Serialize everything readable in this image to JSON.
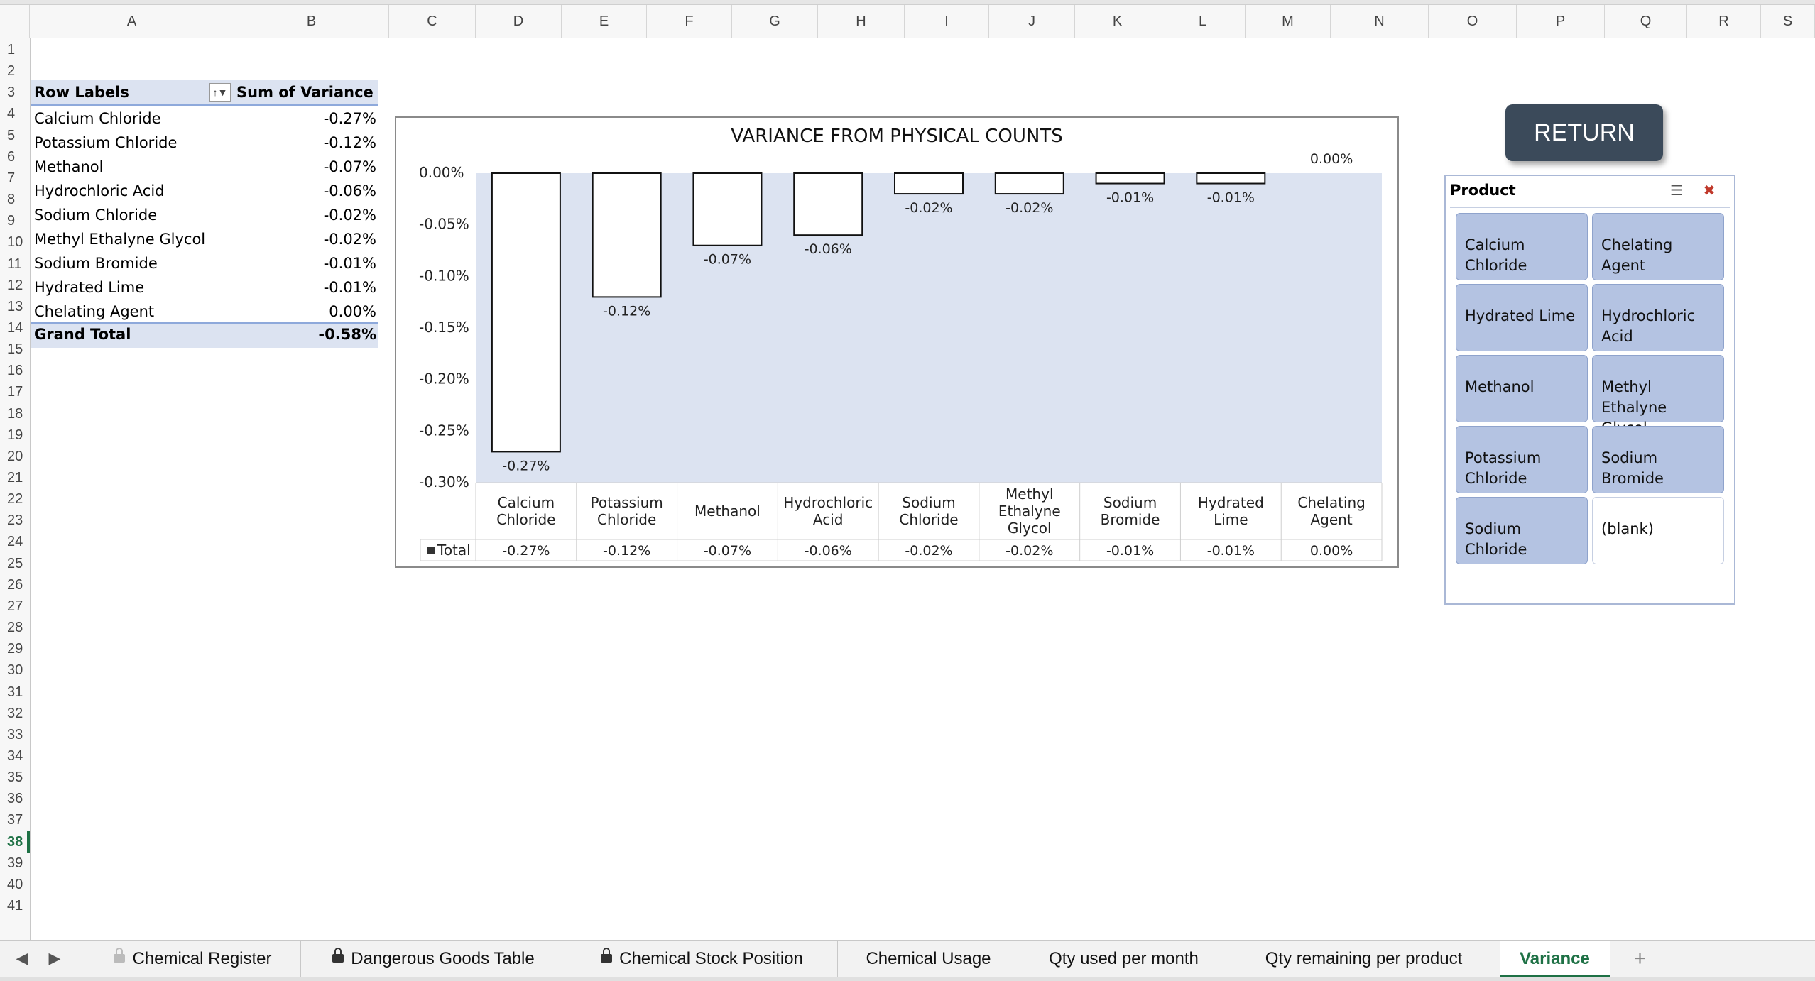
{
  "columns": [
    "A",
    "B",
    "C",
    "D",
    "E",
    "F",
    "G",
    "H",
    "I",
    "J",
    "K",
    "L",
    "M",
    "N",
    "O",
    "P",
    "Q",
    "R",
    "S"
  ],
  "rows": [
    "1",
    "2",
    "3",
    "4",
    "5",
    "6",
    "7",
    "8",
    "9",
    "10",
    "11",
    "12",
    "13",
    "14",
    "15",
    "16",
    "17",
    "18",
    "19",
    "20",
    "21",
    "22",
    "23",
    "24",
    "25",
    "26",
    "27",
    "28",
    "29",
    "30",
    "31",
    "32",
    "33",
    "34",
    "35",
    "36",
    "37",
    "38",
    "39",
    "40",
    "41"
  ],
  "active_row": "38",
  "pivot": {
    "header_label": "Row Labels",
    "header_value": "Sum of Variance",
    "rows": [
      {
        "label": "Calcium Chloride",
        "value": "-0.27%"
      },
      {
        "label": "Potassium Chloride",
        "value": "-0.12%"
      },
      {
        "label": "Methanol",
        "value": "-0.07%"
      },
      {
        "label": "Hydrochloric Acid",
        "value": "-0.06%"
      },
      {
        "label": "Sodium Chloride",
        "value": "-0.02%"
      },
      {
        "label": "Methyl Ethalyne Glycol",
        "value": "-0.02%"
      },
      {
        "label": "Sodium Bromide",
        "value": "-0.01%"
      },
      {
        "label": "Hydrated Lime",
        "value": "-0.01%"
      },
      {
        "label": "Chelating Agent",
        "value": "0.00%"
      }
    ],
    "total_label": "Grand Total",
    "total_value": "-0.58%"
  },
  "chart_data": {
    "type": "bar",
    "title": "VARIANCE FROM PHYSICAL COUNTS",
    "categories": [
      [
        "Calcium",
        "Chloride"
      ],
      [
        "Potassium",
        "Chloride"
      ],
      [
        "Methanol"
      ],
      [
        "Hydrochloric",
        "Acid"
      ],
      [
        "Sodium",
        "Chloride"
      ],
      [
        "Methyl",
        "Ethalyne",
        "Glycol"
      ],
      [
        "Sodium",
        "Bromide"
      ],
      [
        "Hydrated",
        "Lime"
      ],
      [
        "Chelating",
        "Agent"
      ]
    ],
    "series": [
      {
        "name": "Total",
        "values": [
          -0.27,
          -0.12,
          -0.07,
          -0.06,
          -0.02,
          -0.02,
          -0.01,
          -0.01,
          0.0
        ]
      }
    ],
    "data_labels": [
      "-0.27%",
      "-0.12%",
      "-0.07%",
      "-0.06%",
      "-0.02%",
      "-0.02%",
      "-0.01%",
      "-0.01%",
      "0.00%"
    ],
    "ylim": [
      -0.3,
      0.0
    ],
    "yticks": [
      "0.00%",
      "-0.05%",
      "-0.10%",
      "-0.15%",
      "-0.20%",
      "-0.25%",
      "-0.30%"
    ],
    "data_table": true,
    "plot_background": "#dce3f1",
    "bar_fill": "#ffffff"
  },
  "return_button": {
    "label": "RETURN"
  },
  "slicer": {
    "title": "Product",
    "multiselect_icon": "multiselect-icon",
    "clear_filter_icon": "clear-filter-icon",
    "items": [
      {
        "label": "Calcium Chloride",
        "selected": true
      },
      {
        "label": "Chelating Agent",
        "selected": true
      },
      {
        "label": "Hydrated Lime",
        "selected": true
      },
      {
        "label": "Hydrochloric Acid",
        "selected": true
      },
      {
        "label": "Methanol",
        "selected": true
      },
      {
        "label": "Methyl Ethalyne Glycol",
        "selected": true
      },
      {
        "label": "Potassium Chloride",
        "selected": true
      },
      {
        "label": "Sodium Bromide",
        "selected": true
      },
      {
        "label": "Sodium Chloride",
        "selected": true
      },
      {
        "label": "(blank)",
        "selected": false
      }
    ]
  },
  "tabs": [
    {
      "label": "Chemical Register",
      "locked": true,
      "lock_style": "light"
    },
    {
      "label": "Dangerous Goods Table",
      "locked": true,
      "lock_style": "dark"
    },
    {
      "label": "Chemical Stock Position",
      "locked": true,
      "lock_style": "dark"
    },
    {
      "label": "Chemical Usage",
      "locked": false
    },
    {
      "label": "Qty used per month",
      "locked": false
    },
    {
      "label": "Qty remaining per product",
      "locked": false
    },
    {
      "label": "Variance",
      "locked": false,
      "active": true
    }
  ],
  "add_sheet": "+",
  "colors": {
    "accent": "#1e7145",
    "pivot_header": "#dce3f1",
    "slicer_tile": "#b4c3e2",
    "return_button": "#3b4a5a"
  }
}
